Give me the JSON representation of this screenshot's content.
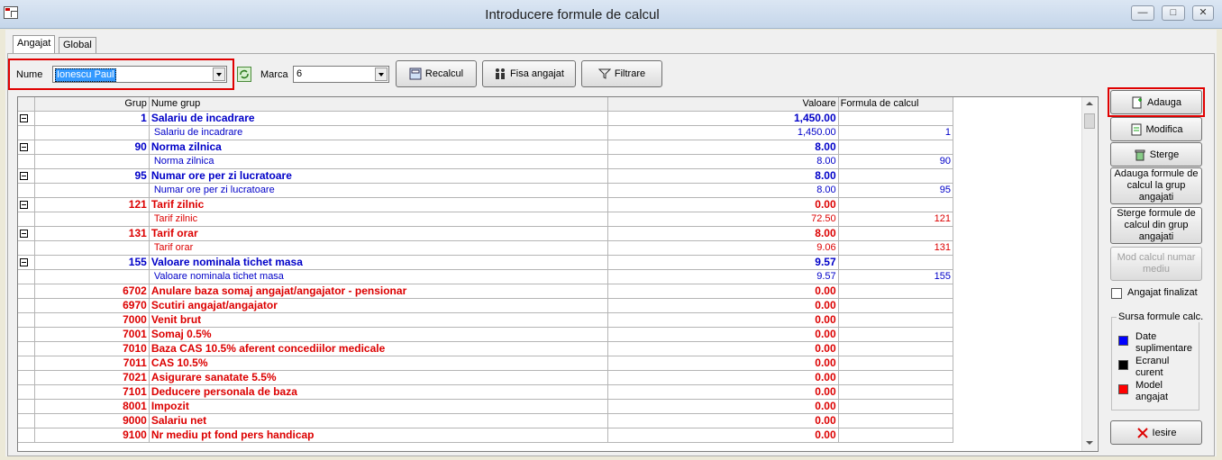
{
  "window": {
    "title": "Introducere formule de calcul"
  },
  "tabs": [
    {
      "label": "Angajat"
    },
    {
      "label": "Global"
    }
  ],
  "filters": {
    "nume_label": "Nume",
    "nume_value": "Ionescu Paul",
    "marca_label": "Marca",
    "marca_value": "6"
  },
  "toolbar": {
    "recalcul": "Recalcul",
    "fisa": "Fisa angajat",
    "filtrare": "Filtrare"
  },
  "grid": {
    "columns": [
      "Grup",
      "Nume grup",
      "Valoare",
      "Formula de calcul"
    ],
    "rows": [
      {
        "grup": "1",
        "nume": "Salariu de incadrare",
        "valoare": "1,450.00",
        "formula": ""
      },
      {
        "grup": "",
        "nume": "Salariu de incadrare",
        "valoare": "1,450.00",
        "formula": "1"
      },
      {
        "grup": "90",
        "nume": "Norma zilnica",
        "valoare": "8.00",
        "formula": ""
      },
      {
        "grup": "",
        "nume": "Norma zilnica",
        "valoare": "8.00",
        "formula": "90"
      },
      {
        "grup": "95",
        "nume": "Numar ore per zi lucratoare",
        "valoare": "8.00",
        "formula": ""
      },
      {
        "grup": "",
        "nume": "Numar ore per zi lucratoare",
        "valoare": "8.00",
        "formula": "95"
      },
      {
        "grup": "121",
        "nume": "Tarif zilnic",
        "valoare": "0.00",
        "formula": ""
      },
      {
        "grup": "",
        "nume": "Tarif zilnic",
        "valoare": "72.50",
        "formula": "121"
      },
      {
        "grup": "131",
        "nume": "Tarif orar",
        "valoare": "8.00",
        "formula": ""
      },
      {
        "grup": "",
        "nume": "Tarif orar",
        "valoare": "9.06",
        "formula": "131"
      },
      {
        "grup": "155",
        "nume": "Valoare nominala tichet masa",
        "valoare": "9.57",
        "formula": ""
      },
      {
        "grup": "",
        "nume": "Valoare nominala tichet masa",
        "valoare": "9.57",
        "formula": "155"
      },
      {
        "grup": "6702",
        "nume": "Anulare baza somaj angajat/angajator - pensionar",
        "valoare": "0.00",
        "formula": ""
      },
      {
        "grup": "6970",
        "nume": "Scutiri angajat/angajator",
        "valoare": "0.00",
        "formula": ""
      },
      {
        "grup": "7000",
        "nume": "Venit brut",
        "valoare": "0.00",
        "formula": ""
      },
      {
        "grup": "7001",
        "nume": "Somaj 0.5%",
        "valoare": "0.00",
        "formula": ""
      },
      {
        "grup": "7010",
        "nume": "Baza CAS 10.5% aferent concediilor medicale",
        "valoare": "0.00",
        "formula": ""
      },
      {
        "grup": "7011",
        "nume": "CAS 10.5%",
        "valoare": "0.00",
        "formula": ""
      },
      {
        "grup": "7021",
        "nume": "Asigurare sanatate 5.5%",
        "valoare": "0.00",
        "formula": ""
      },
      {
        "grup": "7101",
        "nume": "Deducere personala de baza",
        "valoare": "0.00",
        "formula": ""
      },
      {
        "grup": "8001",
        "nume": "Impozit",
        "valoare": "0.00",
        "formula": ""
      },
      {
        "grup": "9000",
        "nume": "Salariu net",
        "valoare": "0.00",
        "formula": ""
      },
      {
        "grup": "9100",
        "nume": "Nr mediu pt fond pers handicap",
        "valoare": "0.00",
        "formula": ""
      }
    ]
  },
  "side": {
    "adauga": "Adauga",
    "modifica": "Modifica",
    "sterge": "Sterge",
    "adauga_grup": "Adauga formule de calcul la grup angajati",
    "sterge_grup": "Sterge formule de calcul din grup angajati",
    "mod_calcul": "Mod calcul numar mediu",
    "angajat_finalizat": "Angajat finalizat",
    "sursa_title": "Sursa formule calc.",
    "legend": [
      {
        "label": "Date suplimentare",
        "color": "#0000ff"
      },
      {
        "label": "Ecranul curent",
        "color": "#000000"
      },
      {
        "label": "Model angajat",
        "color": "#ff0000"
      }
    ],
    "iesire": "Iesire"
  },
  "colors": {
    "blue_rows": "#0000c8",
    "red_rows": "#dc0000",
    "highlight": "#e00000"
  }
}
